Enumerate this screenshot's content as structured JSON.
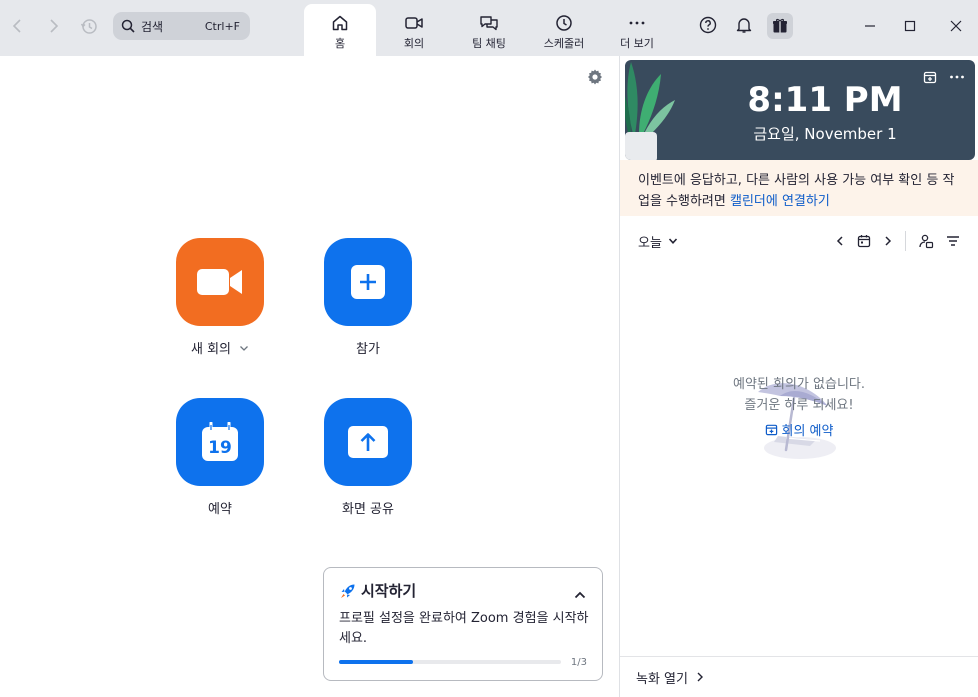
{
  "topbar": {
    "search_placeholder": "검색",
    "search_shortcut": "Ctrl+F",
    "tabs": [
      {
        "label": "홈",
        "icon": "home-icon",
        "active": true
      },
      {
        "label": "회의",
        "icon": "video-icon",
        "active": false
      },
      {
        "label": "팀 채팅",
        "icon": "chat-icon",
        "active": false
      },
      {
        "label": "스케줄러",
        "icon": "clock-icon",
        "active": false
      },
      {
        "label": "더 보기",
        "icon": "more-icon",
        "active": false
      }
    ]
  },
  "home": {
    "actions": [
      {
        "label": "새 회의",
        "icon": "video-camera-icon",
        "color": "#f26d21"
      },
      {
        "label": "참가",
        "icon": "plus-icon",
        "color": "#0e72ed"
      },
      {
        "label": "예약",
        "icon": "calendar-icon",
        "calendar_day": "19",
        "color": "#0e72ed"
      },
      {
        "label": "화면 공유",
        "icon": "share-arrow-icon",
        "color": "#0e72ed"
      }
    ],
    "get_started": {
      "title": "시작하기",
      "description": "프로필 설정을 완료하여 Zoom 경험을 시작하세요.",
      "progress": 0.333,
      "progress_text": "1/3"
    }
  },
  "calendar": {
    "time": "8:11 PM",
    "date": "금요일, November 1",
    "notice_text": "이벤트에 응답하고, 다른 사람의 사용 가능 여부 확인 등 작업을 수행하려면 ",
    "notice_link": "캘린더에 연결하기",
    "day_selector": "오늘",
    "empty_line1": "예약된 회의가 없습니다.",
    "empty_line2": "즐거운 하루 되세요!",
    "schedule_link": "회의 예약",
    "recordings_label": "녹화 열기"
  },
  "colors": {
    "accent": "#0e72ed",
    "orange": "#f26d21",
    "clock_bg": "#394b5d",
    "link": "#0e5cc9"
  }
}
